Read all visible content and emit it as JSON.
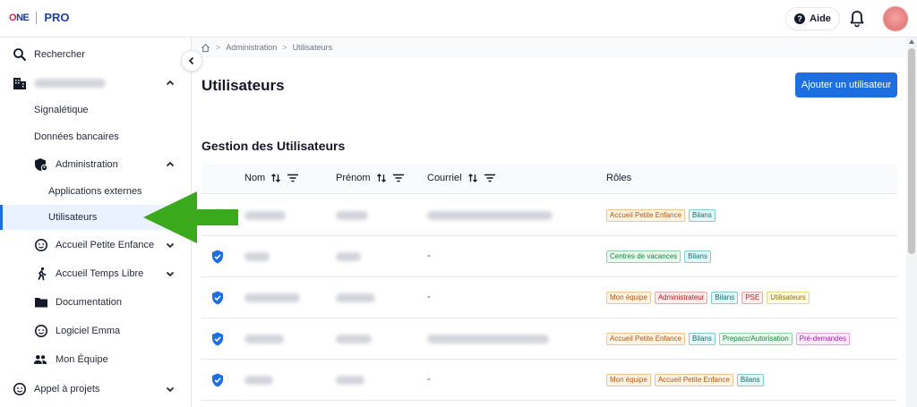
{
  "header": {
    "logo_main": "NE",
    "logo_o": "O",
    "product": "PRO",
    "help_label": "Aide"
  },
  "sidebar": {
    "search": "Rechercher",
    "signaletique": "Signalétique",
    "donnees_bancaires": "Données bancaires",
    "administration": "Administration",
    "applications_externes": "Applications externes",
    "utilisateurs": "Utilisateurs",
    "accueil_petite_enfance": "Accueil Petite Enfance",
    "accueil_temps_libre": "Accueil Temps Libre",
    "documentation": "Documentation",
    "logiciel_emma": "Logiciel Emma",
    "mon_equipe": "Mon Équipe",
    "appel_a_projets": "Appel à projets"
  },
  "breadcrumb": {
    "level1": "Administration",
    "level2": "Utilisateurs"
  },
  "main": {
    "title": "Utilisateurs",
    "add_button": "Ajouter un utilisateur",
    "section_title": "Gestion des Utilisateurs"
  },
  "table": {
    "columns": {
      "nom": "Nom",
      "prenom": "Prénom",
      "courriel": "Courriel",
      "roles": "Rôles"
    },
    "rows": [
      {
        "courriel": "",
        "roles": [
          {
            "label": "Accueil Petite Enfance",
            "color": "orange"
          },
          {
            "label": "Bilans",
            "color": "teal"
          }
        ]
      },
      {
        "courriel": "-",
        "roles": [
          {
            "label": "Centres de vacances",
            "color": "green"
          },
          {
            "label": "Bilans",
            "color": "teal"
          }
        ]
      },
      {
        "courriel": "-",
        "roles": [
          {
            "label": "Mon équipe",
            "color": "orange"
          },
          {
            "label": "Administrateur",
            "color": "red"
          },
          {
            "label": "Bilans",
            "color": "teal"
          },
          {
            "label": "PSE",
            "color": "red"
          },
          {
            "label": "Utilisateurs",
            "color": "yellow"
          }
        ]
      },
      {
        "courriel": "",
        "roles": [
          {
            "label": "Accueil Petite Enfance",
            "color": "orange"
          },
          {
            "label": "Bilans",
            "color": "teal"
          },
          {
            "label": "Prepacc/Autorisation",
            "color": "green"
          },
          {
            "label": "Pré-demandes",
            "color": "pink"
          }
        ]
      },
      {
        "courriel": "-",
        "roles": [
          {
            "label": "Mon équipe",
            "color": "orange"
          },
          {
            "label": "Accueil Petite Enfance",
            "color": "orange"
          },
          {
            "label": "Bilans",
            "color": "teal"
          }
        ]
      }
    ]
  },
  "colors": {
    "accent": "#1d6fe0",
    "arrow": "#3aaa1c",
    "active_bg": "#eaf2ff"
  }
}
